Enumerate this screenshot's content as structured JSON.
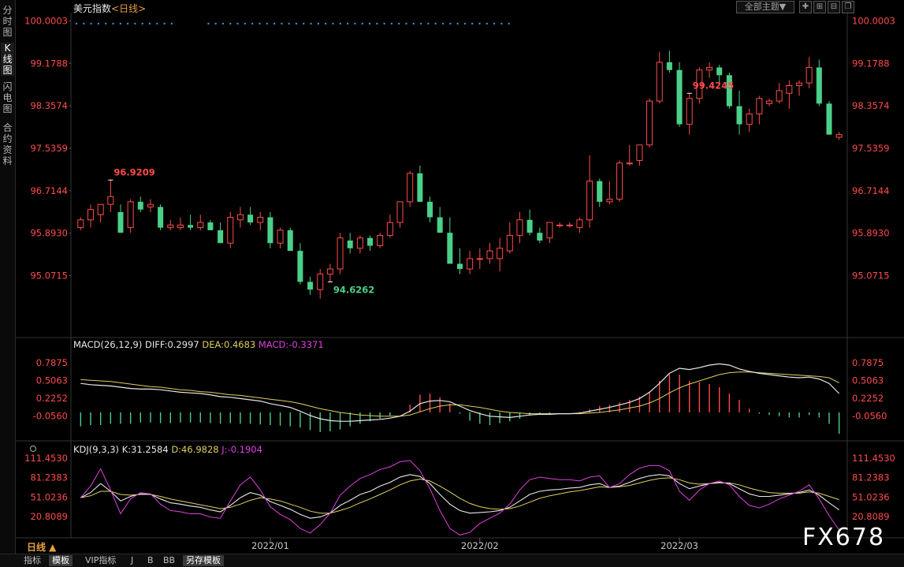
{
  "sidebar": {
    "tabs": [
      {
        "label": "分时图",
        "chars": [
          "分",
          "时",
          "图"
        ]
      },
      {
        "label": "K线图",
        "chars": [
          "K",
          "线",
          "图"
        ]
      },
      {
        "label": "闪电图",
        "chars": [
          "闪",
          "电",
          "图"
        ]
      },
      {
        "label": "合约资料",
        "chars": [
          "合",
          "约",
          "资",
          "料"
        ]
      }
    ]
  },
  "header": {
    "instrument": "美元指数",
    "period_tag": "<日线>",
    "theme_button": "全部主题▼"
  },
  "period_label": "日线 ▲",
  "watermark": "FX678",
  "bottom_tabs": [
    "指标",
    "模板",
    "VIP指标",
    "J",
    "B",
    "BB",
    "另存模板"
  ],
  "colors": {
    "up": "#ff4b4b",
    "down": "#4bd08a",
    "macd": "#e8e8e8",
    "dea": "#e0d060",
    "mag": "#e040e0"
  },
  "chart_data": [
    {
      "type": "candlestick",
      "y_ticks": [
        "100.0003",
        "99.1788",
        "98.3574",
        "97.5359",
        "96.7144",
        "95.8930",
        "95.0715"
      ],
      "ylim": [
        94.3,
        100.1
      ],
      "x_ticks": [
        {
          "label": "2022/01",
          "index": 19
        },
        {
          "label": "2022/02",
          "index": 40
        },
        {
          "label": "2022/03",
          "index": 60
        }
      ],
      "annotations": {
        "high_1": {
          "label": "96.9209",
          "index": 3
        },
        "low": {
          "label": "94.6262",
          "index": 25
        },
        "high_2": {
          "label": "99.4245",
          "index": 61
        }
      },
      "ohlc": [
        [
          96.0,
          96.2,
          95.95,
          96.15
        ],
        [
          96.15,
          96.45,
          96.0,
          96.35
        ],
        [
          96.25,
          96.45,
          96.1,
          96.45
        ],
        [
          96.45,
          96.9209,
          96.3,
          96.6
        ],
        [
          96.3,
          96.45,
          95.9,
          95.9
        ],
        [
          96.0,
          96.55,
          95.9,
          96.5
        ],
        [
          96.5,
          96.6,
          96.3,
          96.35
        ],
        [
          96.4,
          96.55,
          96.3,
          96.45
        ],
        [
          96.4,
          96.45,
          95.95,
          96.0
        ],
        [
          96.0,
          96.15,
          95.95,
          96.05
        ],
        [
          96.0,
          96.2,
          95.95,
          96.05
        ],
        [
          96.05,
          96.25,
          95.95,
          96.0
        ],
        [
          96.0,
          96.25,
          95.95,
          96.1
        ],
        [
          96.1,
          96.15,
          95.95,
          95.95
        ],
        [
          95.95,
          96.1,
          95.75,
          95.7
        ],
        [
          95.7,
          96.3,
          95.6,
          96.2
        ],
        [
          96.15,
          96.4,
          96.0,
          96.25
        ],
        [
          96.25,
          96.4,
          96.05,
          96.1
        ],
        [
          96.1,
          96.3,
          95.95,
          96.2
        ],
        [
          96.2,
          96.3,
          95.6,
          95.7
        ],
        [
          95.7,
          96.0,
          95.6,
          95.95
        ],
        [
          95.95,
          96.0,
          95.55,
          95.55
        ],
        [
          95.55,
          95.7,
          94.9,
          94.95
        ],
        [
          94.95,
          95.05,
          94.7,
          94.8
        ],
        [
          94.8,
          95.2,
          94.6262,
          95.1
        ],
        [
          95.1,
          95.3,
          94.95,
          95.2
        ],
        [
          95.2,
          95.9,
          95.1,
          95.8
        ],
        [
          95.75,
          95.9,
          95.5,
          95.6
        ],
        [
          95.6,
          95.85,
          95.5,
          95.8
        ],
        [
          95.8,
          95.85,
          95.55,
          95.65
        ],
        [
          95.65,
          95.9,
          95.6,
          95.85
        ],
        [
          95.85,
          96.25,
          95.8,
          96.1
        ],
        [
          96.1,
          96.5,
          96.0,
          96.5
        ],
        [
          96.5,
          97.1,
          96.4,
          97.05
        ],
        [
          97.05,
          97.2,
          96.5,
          96.5
        ],
        [
          96.5,
          96.6,
          96.1,
          96.2
        ],
        [
          96.2,
          96.4,
          95.9,
          95.9
        ],
        [
          95.9,
          96.2,
          95.4,
          95.3
        ],
        [
          95.3,
          95.6,
          95.1,
          95.2
        ],
        [
          95.2,
          95.55,
          95.1,
          95.4
        ],
        [
          95.4,
          95.6,
          95.2,
          95.4
        ],
        [
          95.4,
          95.7,
          95.3,
          95.55
        ],
        [
          95.4,
          95.8,
          95.15,
          95.6
        ],
        [
          95.55,
          96.1,
          95.5,
          95.85
        ],
        [
          95.85,
          96.3,
          95.7,
          96.15
        ],
        [
          96.15,
          96.35,
          95.85,
          95.9
        ],
        [
          95.9,
          96.0,
          95.7,
          95.75
        ],
        [
          95.8,
          96.1,
          95.7,
          96.1
        ],
        [
          96.05,
          96.1,
          96.0,
          96.05
        ],
        [
          96.05,
          96.1,
          96.0,
          96.05
        ],
        [
          96.0,
          96.2,
          95.9,
          96.15
        ],
        [
          96.15,
          97.4,
          96.0,
          96.9
        ],
        [
          96.9,
          96.95,
          96.4,
          96.5
        ],
        [
          96.5,
          96.9,
          96.45,
          96.55
        ],
        [
          96.55,
          97.3,
          96.5,
          97.25
        ],
        [
          97.25,
          97.6,
          97.2,
          97.25
        ],
        [
          97.3,
          97.6,
          97.2,
          97.6
        ],
        [
          97.6,
          98.5,
          97.55,
          98.45
        ],
        [
          98.45,
          99.4,
          98.4,
          99.2
        ],
        [
          99.2,
          99.4245,
          99.0,
          99.05
        ],
        [
          99.05,
          99.2,
          97.95,
          98.0
        ],
        [
          98.0,
          98.6,
          97.8,
          98.5
        ],
        [
          98.5,
          99.1,
          98.4,
          99.05
        ],
        [
          99.05,
          99.2,
          98.9,
          99.1
        ],
        [
          99.1,
          99.15,
          98.8,
          98.95
        ],
        [
          98.95,
          99.0,
          98.3,
          98.35
        ],
        [
          98.35,
          98.65,
          97.8,
          98.0
        ],
        [
          98.0,
          98.3,
          97.85,
          98.2
        ],
        [
          98.2,
          98.55,
          98.0,
          98.5
        ],
        [
          98.4,
          98.5,
          98.35,
          98.45
        ],
        [
          98.45,
          98.8,
          98.4,
          98.65
        ],
        [
          98.6,
          98.85,
          98.3,
          98.75
        ],
        [
          98.75,
          98.85,
          98.55,
          98.8
        ],
        [
          98.8,
          99.3,
          98.7,
          99.1
        ],
        [
          99.1,
          99.25,
          98.35,
          98.4
        ],
        [
          98.4,
          98.45,
          97.8,
          97.8
        ],
        [
          97.75,
          97.85,
          97.7,
          97.8
        ]
      ]
    },
    {
      "type": "bar+line",
      "title": "MACD(26,12,9)",
      "readouts": {
        "diff": "DIFF:0.2997",
        "dea": "DEA:0.4683",
        "macd": "MACD:-0.3371"
      },
      "y_ticks": [
        "0.7875",
        "0.5063",
        "0.2252",
        "-0.0560"
      ],
      "ylim": [
        -0.4,
        0.95
      ],
      "diff": [
        0.46,
        0.44,
        0.43,
        0.42,
        0.4,
        0.38,
        0.37,
        0.37,
        0.36,
        0.34,
        0.32,
        0.31,
        0.3,
        0.28,
        0.25,
        0.24,
        0.22,
        0.2,
        0.18,
        0.14,
        0.11,
        0.08,
        0.02,
        -0.05,
        -0.1,
        -0.13,
        -0.14,
        -0.14,
        -0.13,
        -0.12,
        -0.11,
        -0.09,
        -0.06,
        0.02,
        0.14,
        0.18,
        0.19,
        0.17,
        0.1,
        0.03,
        -0.02,
        -0.06,
        -0.07,
        -0.08,
        -0.06,
        -0.04,
        -0.03,
        -0.03,
        -0.02,
        -0.02,
        -0.01,
        0.02,
        0.05,
        0.08,
        0.12,
        0.16,
        0.22,
        0.32,
        0.46,
        0.62,
        0.7,
        0.68,
        0.71,
        0.75,
        0.77,
        0.75,
        0.69,
        0.65,
        0.62,
        0.6,
        0.58,
        0.56,
        0.55,
        0.56,
        0.53,
        0.46,
        0.3
      ],
      "dea": [
        0.52,
        0.51,
        0.5,
        0.49,
        0.47,
        0.45,
        0.43,
        0.41,
        0.4,
        0.38,
        0.36,
        0.35,
        0.33,
        0.32,
        0.3,
        0.28,
        0.27,
        0.25,
        0.23,
        0.21,
        0.19,
        0.17,
        0.14,
        0.1,
        0.06,
        0.03,
        0.0,
        -0.02,
        -0.04,
        -0.05,
        -0.06,
        -0.06,
        -0.06,
        -0.04,
        0.01,
        0.06,
        0.1,
        0.12,
        0.12,
        0.1,
        0.08,
        0.05,
        0.02,
        0.0,
        -0.01,
        -0.02,
        -0.02,
        -0.02,
        -0.02,
        -0.02,
        -0.02,
        -0.01,
        0.0,
        0.02,
        0.04,
        0.07,
        0.1,
        0.15,
        0.22,
        0.31,
        0.39,
        0.45,
        0.5,
        0.55,
        0.6,
        0.63,
        0.64,
        0.64,
        0.63,
        0.62,
        0.61,
        0.6,
        0.59,
        0.58,
        0.57,
        0.55,
        0.47
      ],
      "hist": [
        -0.22,
        -0.2,
        -0.2,
        -0.18,
        -0.18,
        -0.18,
        -0.16,
        -0.16,
        -0.17,
        -0.17,
        -0.16,
        -0.16,
        -0.16,
        -0.17,
        -0.18,
        -0.17,
        -0.18,
        -0.18,
        -0.19,
        -0.2,
        -0.21,
        -0.22,
        -0.24,
        -0.28,
        -0.31,
        -0.3,
        -0.27,
        -0.22,
        -0.18,
        -0.14,
        -0.1,
        -0.05,
        0.0,
        0.12,
        0.28,
        0.3,
        0.24,
        0.14,
        -0.02,
        -0.13,
        -0.18,
        -0.2,
        -0.17,
        -0.14,
        -0.1,
        -0.05,
        -0.02,
        -0.02,
        0.0,
        0.0,
        0.01,
        0.05,
        0.1,
        0.12,
        0.16,
        0.2,
        0.25,
        0.33,
        0.5,
        0.6,
        0.6,
        0.5,
        0.48,
        0.45,
        0.4,
        0.3,
        0.2,
        0.06,
        -0.02,
        -0.04,
        -0.06,
        -0.08,
        -0.08,
        -0.04,
        -0.08,
        -0.18,
        -0.34
      ]
    },
    {
      "type": "line",
      "title": "KDJ(9,3,3)",
      "readouts": {
        "k": "K:31.2584",
        "d": "D:46.9828",
        "j": "J:-0.1904"
      },
      "y_ticks": [
        "111.4530",
        "81.2383",
        "51.0236",
        "20.8089"
      ],
      "ylim": [
        -10,
        125
      ],
      "k": [
        50,
        58,
        72,
        60,
        45,
        52,
        56,
        55,
        48,
        42,
        40,
        37,
        35,
        31,
        28,
        38,
        50,
        58,
        54,
        44,
        38,
        32,
        24,
        18,
        20,
        26,
        38,
        46,
        55,
        60,
        68,
        74,
        82,
        86,
        83,
        72,
        55,
        40,
        30,
        26,
        27,
        28,
        30,
        35,
        45,
        55,
        60,
        62,
        63,
        65,
        66,
        70,
        72,
        66,
        68,
        74,
        80,
        84,
        86,
        84,
        72,
        64,
        68,
        72,
        74,
        72,
        64,
        56,
        52,
        52,
        54,
        56,
        58,
        62,
        54,
        42,
        31
      ],
      "d": [
        50,
        53,
        60,
        60,
        55,
        54,
        55,
        55,
        52,
        48,
        45,
        42,
        39,
        36,
        33,
        35,
        40,
        46,
        50,
        48,
        45,
        40,
        35,
        29,
        26,
        26,
        30,
        35,
        42,
        48,
        55,
        62,
        70,
        76,
        79,
        76,
        68,
        59,
        49,
        41,
        36,
        33,
        32,
        33,
        37,
        43,
        49,
        53,
        56,
        59,
        61,
        64,
        67,
        66,
        67,
        69,
        73,
        77,
        80,
        81,
        78,
        73,
        71,
        72,
        73,
        73,
        70,
        65,
        61,
        58,
        57,
        57,
        57,
        59,
        57,
        52,
        47
      ],
      "j": [
        50,
        68,
        95,
        62,
        25,
        48,
        58,
        56,
        40,
        30,
        28,
        25,
        25,
        20,
        18,
        45,
        70,
        82,
        62,
        36,
        24,
        16,
        2,
        -5,
        8,
        26,
        54,
        68,
        80,
        86,
        94,
        98,
        106,
        108,
        92,
        64,
        30,
        2,
        -8,
        -4,
        10,
        18,
        26,
        40,
        62,
        78,
        82,
        80,
        78,
        78,
        76,
        82,
        84,
        66,
        72,
        86,
        96,
        100,
        100,
        92,
        60,
        46,
        62,
        72,
        76,
        70,
        52,
        38,
        34,
        40,
        48,
        54,
        60,
        70,
        48,
        22,
        -0.2
      ]
    }
  ]
}
